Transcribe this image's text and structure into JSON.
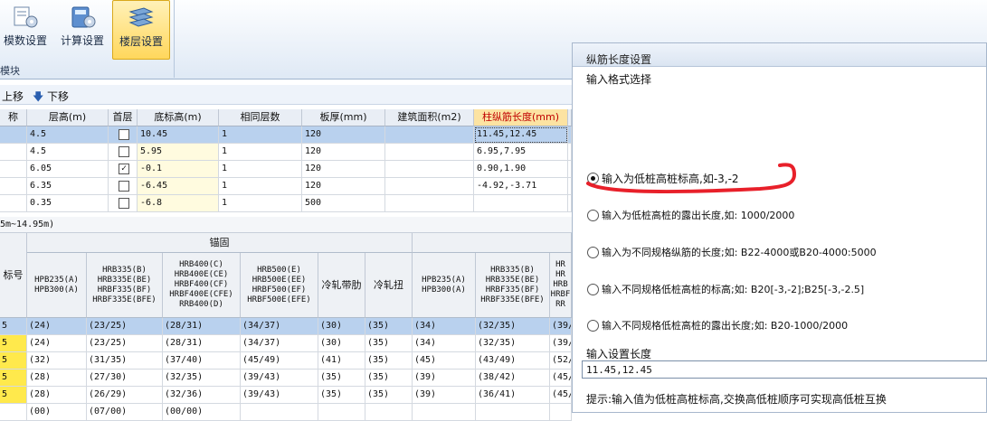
{
  "ribbon": {
    "buttons": [
      {
        "label": "模数设置"
      },
      {
        "label": "计算设置"
      },
      {
        "label": "楼层设置"
      }
    ],
    "group_label": "模块"
  },
  "toolbar": {
    "up": "上移",
    "down": "下移"
  },
  "floor_table": {
    "headers": [
      "称",
      "层高(m)",
      "首层",
      "底标高(m)",
      "相同层数",
      "板厚(mm)",
      "建筑面积(m2)",
      "柱纵筋长度(mm)"
    ],
    "rows": [
      {
        "height": "4.5",
        "first": false,
        "bottom": "10.45",
        "same": "1",
        "thick": "120",
        "area": "",
        "length": "11.45,12.45"
      },
      {
        "height": "4.5",
        "first": false,
        "bottom": "5.95",
        "same": "1",
        "thick": "120",
        "area": "",
        "length": "6.95,7.95"
      },
      {
        "height": "6.05",
        "first": true,
        "bottom": "-0.1",
        "same": "1",
        "thick": "120",
        "area": "",
        "length": "0.90,1.90"
      },
      {
        "height": "6.35",
        "first": false,
        "bottom": "-6.45",
        "same": "1",
        "thick": "120",
        "area": "",
        "length": "-4.92,-3.71"
      },
      {
        "height": "0.35",
        "first": false,
        "bottom": "-6.8",
        "same": "1",
        "thick": "500",
        "area": "",
        "length": ""
      }
    ]
  },
  "section_label": "5m~14.95m)",
  "anchor_table": {
    "group": "锚固",
    "rowhead": "标号",
    "headers": [
      "HPB235(A)\nHPB300(A)",
      "HRB335(B)\nHRB335E(BE)\nHRBF335(BF)\nHRBF335E(BFE)",
      "HRB400(C)\nHRB400E(CE)\nHRBF400(CF)\nHRBF400E(CFE)\nRRB400(D)",
      "HRB500(E)\nHRB500E(EE)\nHRBF500(EF)\nHRBF500E(EFE)",
      "冷轧带肋",
      "冷轧扭",
      "HPB235(A)\nHPB300(A)",
      "HRB335(B)\nHRB335E(BE)\nHRBF335(BF)\nHRBF335E(BFE)",
      "HR\nHR\nHRB\nHRBF\nRR"
    ],
    "rows": [
      [
        "5",
        "(24)",
        "(23/25)",
        "(28/31)",
        "(34/37)",
        "(30)",
        "(35)",
        "(34)",
        "(32/35)",
        "(39/"
      ],
      [
        "5",
        "(24)",
        "(23/25)",
        "(28/31)",
        "(34/37)",
        "(30)",
        "(35)",
        "(34)",
        "(32/35)",
        "(39/"
      ],
      [
        "5",
        "(32)",
        "(31/35)",
        "(37/40)",
        "(45/49)",
        "(41)",
        "(35)",
        "(45)",
        "(43/49)",
        "(52/"
      ],
      [
        "5",
        "(28)",
        "(27/30)",
        "(32/35)",
        "(39/43)",
        "(35)",
        "(35)",
        "(39)",
        "(38/42)",
        "(45/"
      ],
      [
        "5",
        "(28)",
        "(26/29)",
        "(32/36)",
        "(39/43)",
        "(35)",
        "(35)",
        "(39)",
        "(36/41)",
        "(45/"
      ],
      [
        "",
        "(00)",
        "(07/00)",
        "(00/00)",
        "",
        "",
        "",
        "",
        "",
        ""
      ]
    ]
  },
  "dialog": {
    "title": "纵筋长度设置",
    "format_label": "输入格式选择",
    "options": [
      "输入为低桩高桩标高,如-3,-2",
      "输入为低桩高桩的露出长度,如: 1000/2000",
      "输入为不同规格纵筋的长度;如: B22-4000或B20-4000:5000",
      "输入不同规格低桩高桩的标高;如: B20[-3,-2];B25[-3,-2.5]",
      "输入不同规格低桩高桩的露出长度;如: B20-1000/2000"
    ],
    "length_label": "输入设置长度",
    "length_value": "11.45,12.45",
    "hint": "提示:输入值为低桩高桩标高,交换高低桩顺序可实现高低桩互换"
  },
  "colors": {
    "accent": "#ffd75c",
    "annotation": "#e8202a",
    "selection": "#b9d1ee"
  }
}
